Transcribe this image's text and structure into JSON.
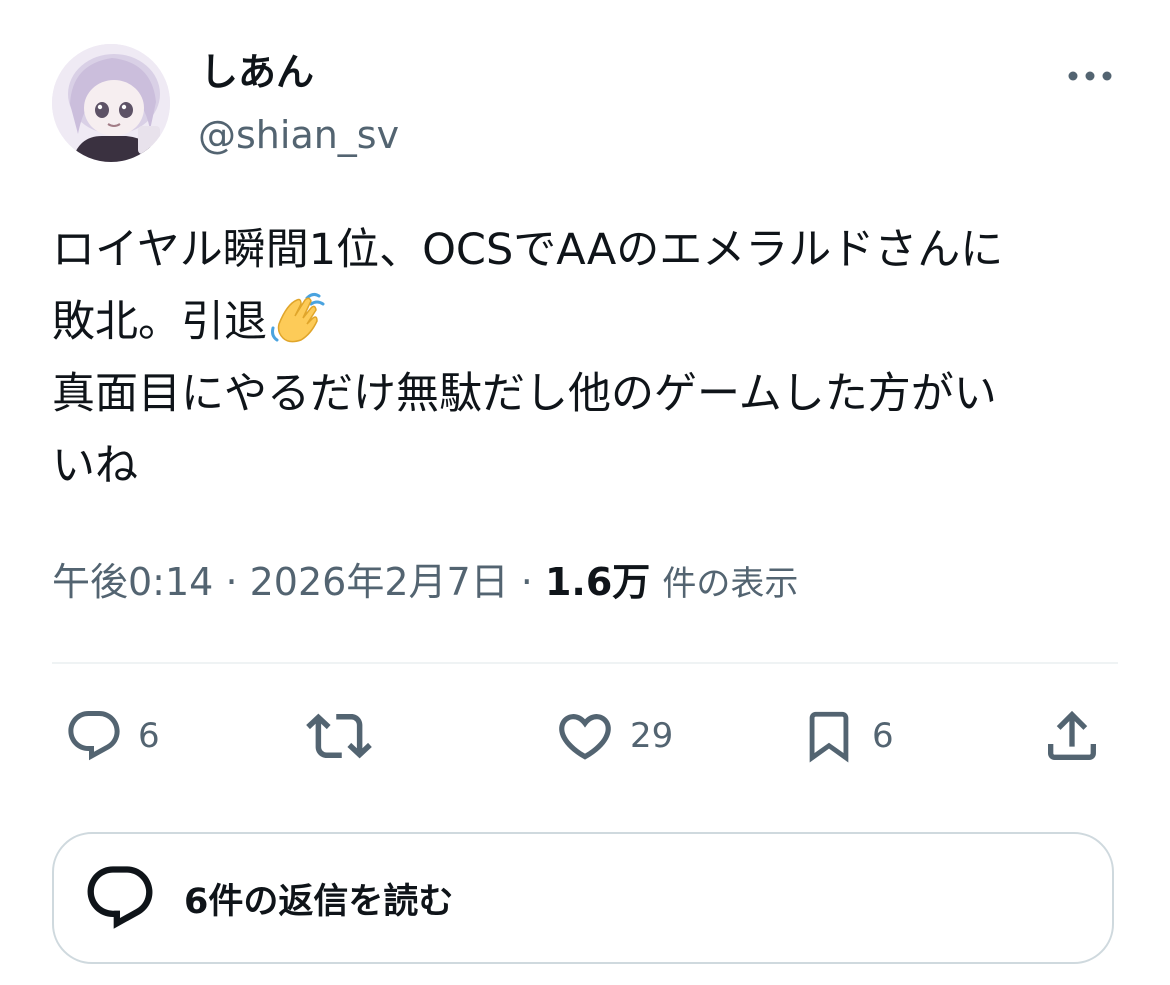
{
  "author": {
    "display_name": "しあん",
    "handle": "@shian_sv"
  },
  "tweet": {
    "text_line1": "ロイヤル瞬間1位、OCSでAAのエメラルドさんに",
    "text_line2": "敗北。引退",
    "text_line3": "真面目にやるだけ無駄だし他のゲームした方がい",
    "text_line4": "いね",
    "emoji": "waving-hand"
  },
  "meta": {
    "time": "午後0:14",
    "separator": "·",
    "date": "2026年2月7日",
    "views_count": "1.6万",
    "views_label": "件の表示"
  },
  "actions": {
    "reply_count": "6",
    "retweet_count": "",
    "like_count": "29",
    "bookmark_count": "6"
  },
  "replies": {
    "label": "6件の返信を読む"
  },
  "colors": {
    "text_primary": "#0f1419",
    "text_secondary": "#536471",
    "divider": "#eff3f4",
    "border": "#cfd9de",
    "icon": "#536471"
  }
}
